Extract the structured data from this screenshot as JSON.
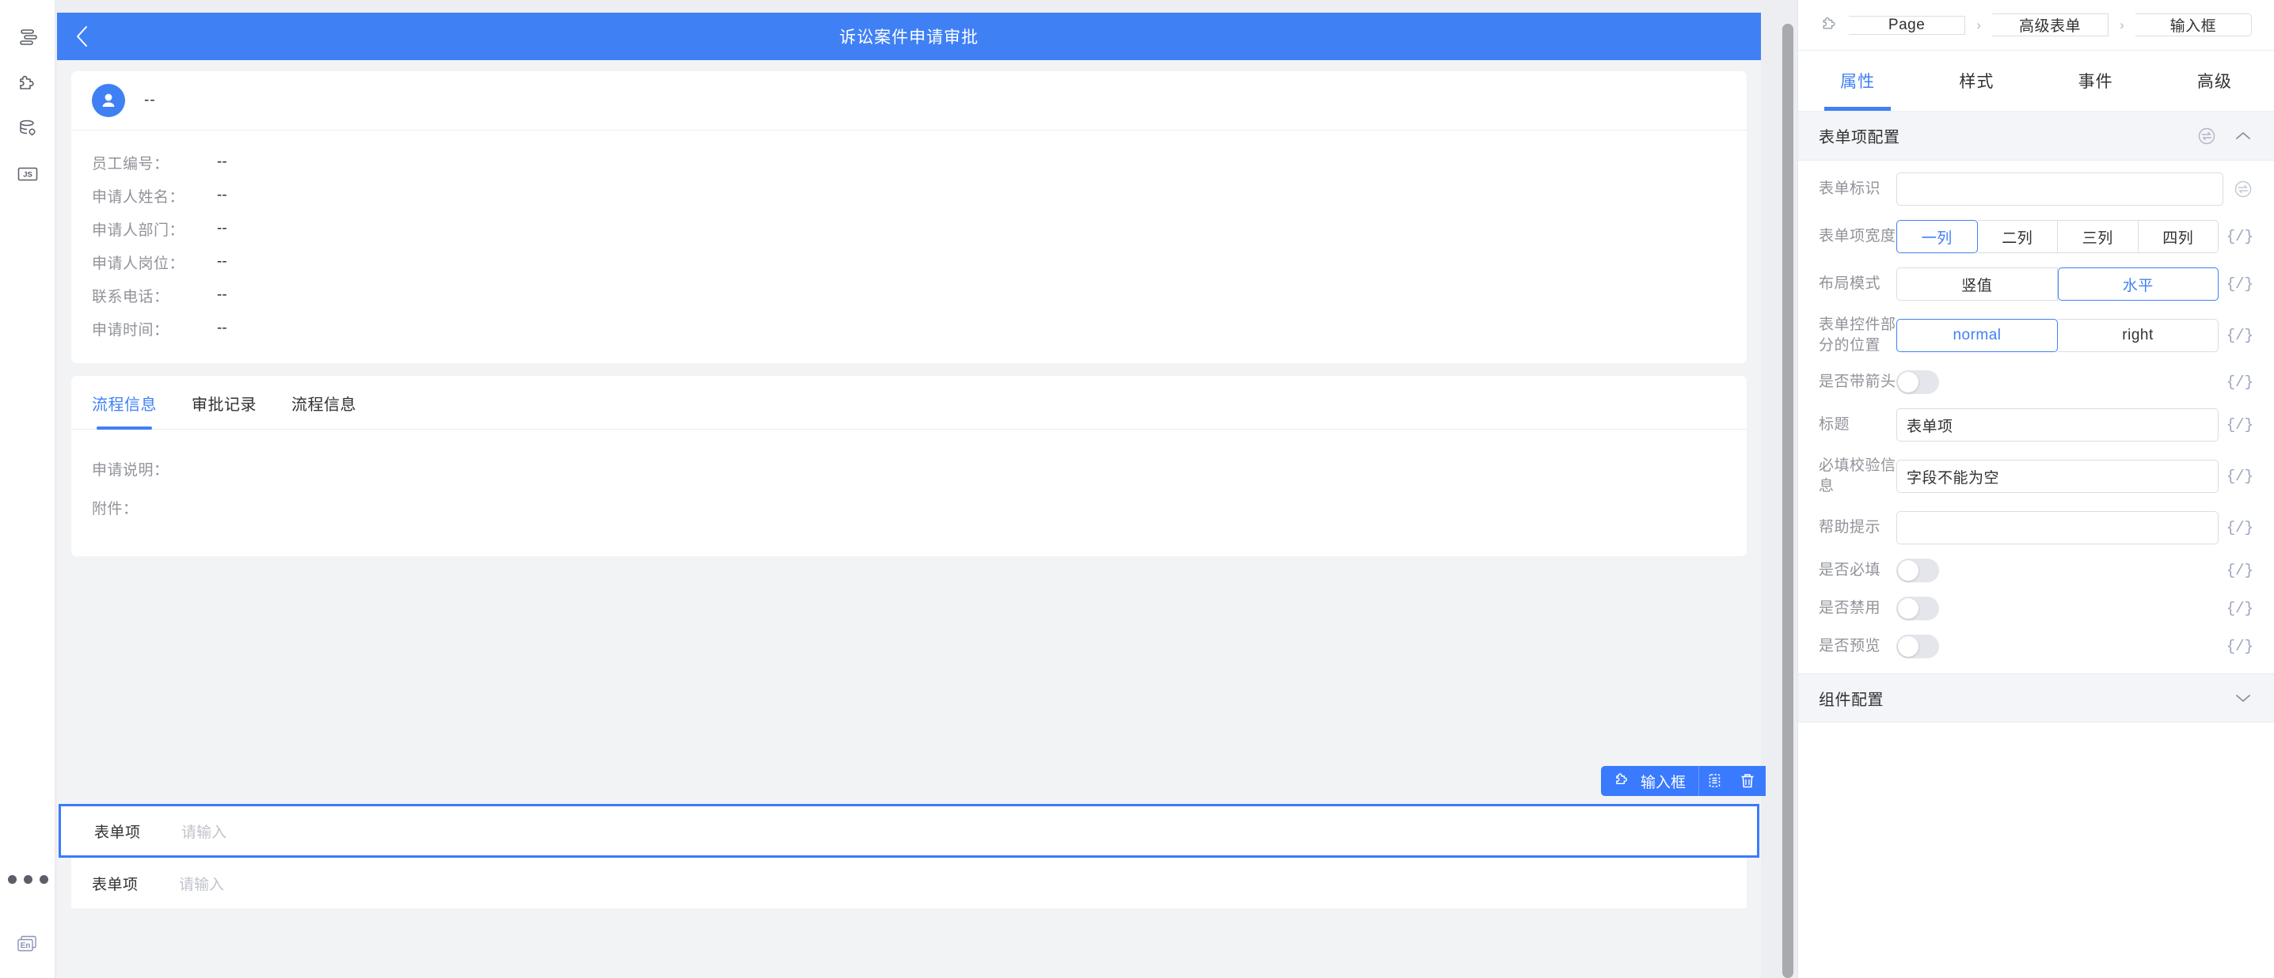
{
  "left_rail": {
    "items": [
      {
        "name": "outline-icon",
        "label": "大纲"
      },
      {
        "name": "components-icon",
        "label": "组件"
      },
      {
        "name": "datasource-icon",
        "label": "数据源"
      },
      {
        "name": "js-icon",
        "label": "JS"
      }
    ],
    "more_label": "更多",
    "lang_label": "En"
  },
  "canvas": {
    "app_bar": {
      "back_label": "返回",
      "title": "诉讼案件申请审批"
    },
    "user_card": {
      "user_name": "--",
      "rows": [
        {
          "label": "员工编号：",
          "value": "--"
        },
        {
          "label": "申请人姓名：",
          "value": "--"
        },
        {
          "label": "申请人部门：",
          "value": "--"
        },
        {
          "label": "申请人岗位：",
          "value": "--"
        },
        {
          "label": "联系电话：",
          "value": "--"
        },
        {
          "label": "申请时间：",
          "value": "--"
        }
      ]
    },
    "tabs_card": {
      "tabs": [
        {
          "label": "流程信息",
          "active": true
        },
        {
          "label": "审批记录",
          "active": false
        },
        {
          "label": "流程信息",
          "active": false
        }
      ],
      "fields": [
        {
          "label": "申请说明："
        },
        {
          "label": "附件："
        }
      ]
    },
    "selection_toolbar": {
      "component_label": "输入框",
      "copy_label": "复制",
      "delete_label": "删除"
    },
    "form_rows": [
      {
        "label": "表单项",
        "placeholder": "请输入",
        "selected": true
      },
      {
        "label": "表单项",
        "placeholder": "请输入",
        "selected": false
      }
    ]
  },
  "panel": {
    "breadcrumb": {
      "root": "Page",
      "sep": "›",
      "middle": "高级表单",
      "current": "输入框"
    },
    "tabs": [
      {
        "label": "属性",
        "active": true
      },
      {
        "label": "样式",
        "active": false
      },
      {
        "label": "事件",
        "active": false
      },
      {
        "label": "高级",
        "active": false
      }
    ],
    "form_section": {
      "title": "表单项配置",
      "collapsed": false,
      "rows": {
        "form_id": {
          "label": "表单标识",
          "value": "",
          "placeholder": ""
        },
        "item_width": {
          "label": "表单项宽度",
          "options": [
            "一列",
            "二列",
            "三列",
            "四列"
          ],
          "selected": "一列",
          "code_label": "{/}"
        },
        "layout_mode": {
          "label": "布局模式",
          "options": [
            "竖值",
            "水平"
          ],
          "selected": "水平",
          "code_label": "{/}"
        },
        "control_position": {
          "label": "表单控件部分的位置",
          "options": [
            "normal",
            "right"
          ],
          "selected": "normal",
          "code_label": "{/}"
        },
        "with_arrow": {
          "label": "是否带箭头",
          "value": false,
          "code_label": "{/}"
        },
        "title": {
          "label": "标题",
          "value": "表单项",
          "code_label": "{/}"
        },
        "required_message": {
          "label": "必填校验信息",
          "value": "字段不能为空",
          "code_label": "{/}"
        },
        "help_tip": {
          "label": "帮助提示",
          "value": "",
          "code_label": "{/}"
        },
        "is_required": {
          "label": "是否必填",
          "value": false,
          "code_label": "{/}"
        },
        "is_disabled": {
          "label": "是否禁用",
          "value": false,
          "code_label": "{/}"
        },
        "is_preview": {
          "label": "是否预览",
          "value": false,
          "code_label": "{/}"
        }
      }
    },
    "component_section": {
      "title": "组件配置",
      "collapsed": true
    }
  },
  "colors": {
    "primary": "#4080f5",
    "selection": "#3a7afe",
    "canvas_bg": "#eceef1",
    "panel_bg": "#ffffff",
    "muted_text": "#909399",
    "code_token": "#9aa3c0"
  }
}
